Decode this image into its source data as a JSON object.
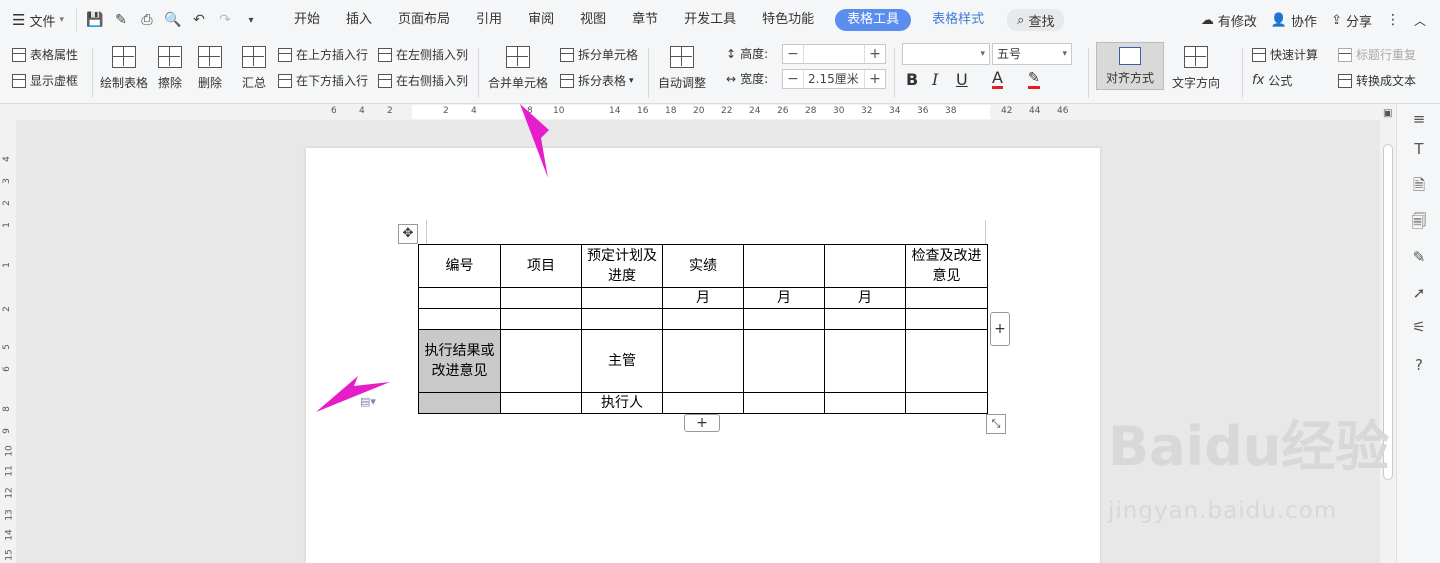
{
  "menubar": {
    "file_label": "文件",
    "tabs": [
      "开始",
      "插入",
      "页面布局",
      "引用",
      "审阅",
      "视图",
      "章节",
      "开发工具",
      "特色功能"
    ],
    "active_tab": "表格工具",
    "second_tab": "表格样式",
    "search_label": "查找",
    "right": {
      "modified": "有修改",
      "collab": "协作",
      "share": "分享"
    }
  },
  "ribbon": {
    "table_props": "表格属性",
    "show_gridlines": "显示虚框",
    "draw_table": "绘制表格",
    "erase": "擦除",
    "delete": "删除",
    "summary": "汇总",
    "insert_row_above": "在上方插入行",
    "insert_row_below": "在下方插入行",
    "insert_col_left": "在左侧插入列",
    "insert_col_right": "在右侧插入列",
    "merge_cells": "合并单元格",
    "split_cells": "拆分单元格",
    "split_table": "拆分表格",
    "auto_fit": "自动调整",
    "height_label": "高度:",
    "height_value": "",
    "width_label": "宽度:",
    "width_value": "2.15厘米",
    "font_name": "",
    "font_size": "五号",
    "bold": "B",
    "italic": "I",
    "underline": "U",
    "font_color": "A",
    "align": "对齐方式",
    "text_direction": "文字方向",
    "quick_calc": "快速计算",
    "formula": "公式",
    "repeat_header": "标题行重复",
    "convert_text": "转换成文本"
  },
  "ruler_numbers": [
    "6",
    "4",
    "2",
    "2",
    "4",
    "8",
    "10",
    "14",
    "16",
    "18",
    "20",
    "22",
    "24",
    "26",
    "28",
    "30",
    "32",
    "34",
    "36",
    "38",
    "42",
    "44",
    "46"
  ],
  "vruler_numbers": [
    "4",
    "3",
    "2",
    "1",
    "1",
    "2",
    "5",
    "6",
    "8",
    "9",
    "10",
    "11",
    "12",
    "13",
    "14",
    "15"
  ],
  "table": {
    "rows": [
      [
        "编号",
        "项目",
        "预定计划及进度",
        "实绩",
        "",
        "",
        "检查及改进意见"
      ],
      [
        "",
        "",
        "",
        "月",
        "月",
        "月",
        ""
      ],
      [
        "",
        "",
        "",
        "",
        "",
        "",
        ""
      ],
      [
        "执行结果或改进意见",
        "",
        "主管",
        "",
        "",
        "",
        ""
      ],
      [
        "",
        "",
        "执行人",
        "",
        "",
        "",
        ""
      ]
    ]
  },
  "watermark": {
    "brand": "Baidu经验",
    "url": "jingyan.baidu.com"
  },
  "colors": {
    "accent": "#5b8def",
    "arrow": "#e51ec9",
    "cell_gray": "#c9c9c9"
  }
}
